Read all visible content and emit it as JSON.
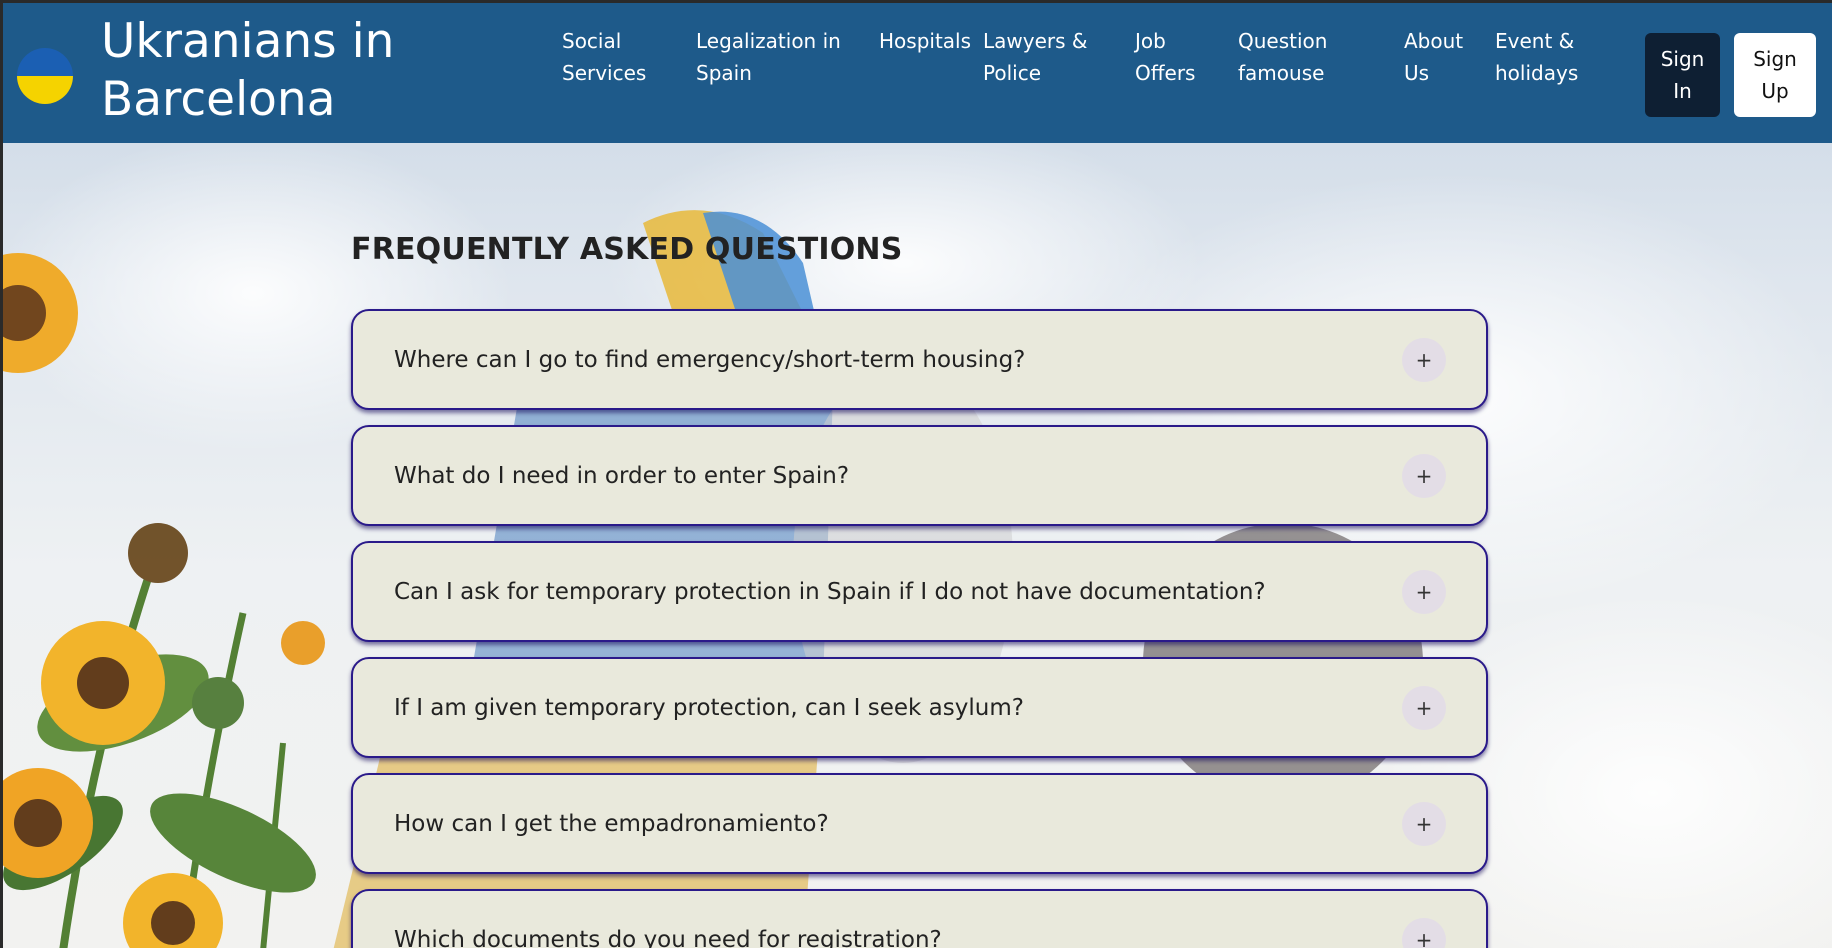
{
  "header": {
    "brand": "Ukranians in Barcelona",
    "nav": [
      {
        "label": "Social Services",
        "lines": [
          "Social",
          "Services"
        ]
      },
      {
        "label": "Legalization in Spain",
        "lines": [
          "Legalization in",
          "Spain"
        ]
      },
      {
        "label": "Hospitals",
        "lines": [
          "Hospitals",
          ""
        ]
      },
      {
        "label": "Lawyers & Police",
        "lines": [
          "Lawyers &",
          "Police"
        ]
      },
      {
        "label": "Job Offers",
        "lines": [
          "Job",
          "Offers"
        ]
      },
      {
        "label": "Question famouse",
        "lines": [
          "Question",
          "famouse"
        ]
      },
      {
        "label": "About Us",
        "lines": [
          "About",
          "Us"
        ]
      },
      {
        "label": "Event & holidays",
        "lines": [
          "Event &",
          "holidays"
        ]
      }
    ],
    "sign_in": [
      "Sign",
      "In"
    ],
    "sign_up": [
      "Sign",
      "Up"
    ],
    "colors": {
      "navbar": "#1e5a8a",
      "sign_in_bg": "#0e1f33",
      "flag_blue": "#1b5fb3",
      "flag_yellow": "#f5d300"
    }
  },
  "faq": {
    "title": "FREQUENTLY ASKED QUESTIONS",
    "items": [
      {
        "question": "Where can I go to find emergency/short-term housing?",
        "icon": "plus-icon"
      },
      {
        "question": "What do I need in order to enter Spain?",
        "icon": "plus-icon"
      },
      {
        "question": "Can I ask for temporary protection in Spain if I do not have documentation?",
        "icon": "plus-icon"
      },
      {
        "question": "If I am given temporary protection, can I seek asylum?",
        "icon": "plus-icon"
      },
      {
        "question": "How can I get the empadronamiento?",
        "icon": "plus-icon"
      },
      {
        "question": "Which documents do you need for registration?",
        "icon": "plus-icon"
      }
    ],
    "plus_symbol": "+"
  }
}
